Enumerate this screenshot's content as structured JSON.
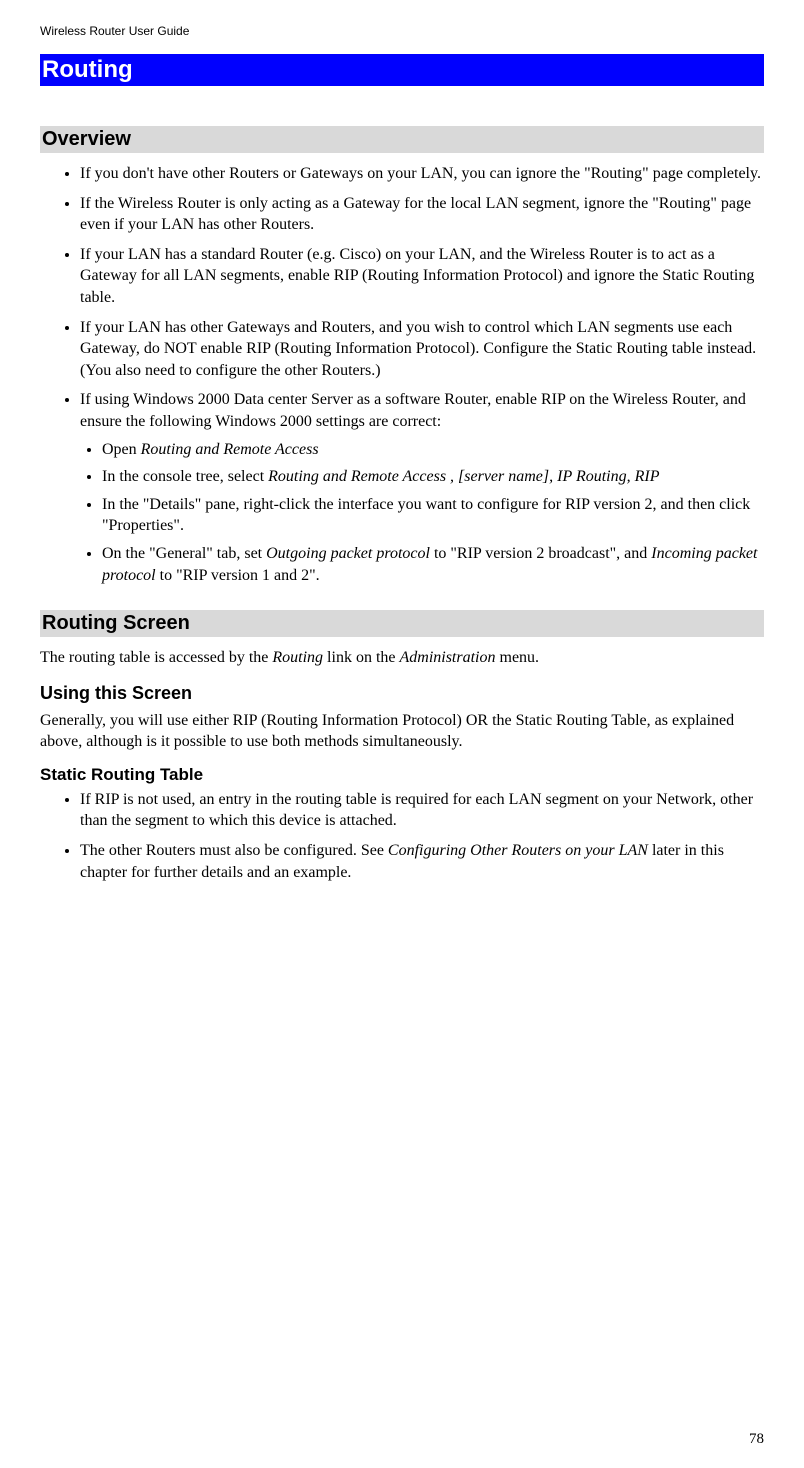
{
  "doc_header": "Wireless Router User Guide",
  "banner": "Routing",
  "overview": {
    "heading": "Overview",
    "items": {
      "b1": "If you don't have other Routers or Gateways on your LAN, you can ignore the \"Routing\" page completely.",
      "b2": "If the Wireless Router is only acting as a Gateway for the local LAN segment, ignore the \"Routing\" page even if your LAN has other Routers.",
      "b3": "If your LAN has a standard Router (e.g. Cisco) on your LAN, and the Wireless Router is to act as a Gateway for all LAN segments, enable RIP (Routing Information Protocol) and ignore the Static Routing table.",
      "b4": "If your LAN has other Gateways and Routers, and you wish to control which LAN segments use each Gateway, do NOT enable RIP (Routing Information Protocol). Configure the Static Routing table instead. (You also need to configure the other Routers.)",
      "b5": "If using Windows 2000 Data center Server as a software Router, enable RIP on the Wireless Router, and ensure the following Windows 2000 settings are correct:",
      "inner": {
        "i1_pre": "Open ",
        "i1_em": "Routing and Remote Access",
        "i2_pre": "In the console tree, select ",
        "i2_em": "Routing and Remote Access , [server name], IP Routing, RIP",
        "i3": "In the \"Details\" pane, right-click the interface you want to configure for RIP version 2, and then click \"Properties\".",
        "i4_pre": "On the \"General\" tab, set ",
        "i4_em1": "Outgoing packet protocol",
        "i4_mid": " to \"RIP version 2 broadcast\", and ",
        "i4_em2": "Incoming packet protocol",
        "i4_post": " to \"RIP version 1 and 2\"."
      }
    }
  },
  "routing_screen": {
    "heading": "Routing Screen",
    "p1_pre": "The routing table is accessed by the ",
    "p1_em1": "Routing",
    "p1_mid": " link on the ",
    "p1_em2": "Administration",
    "p1_post": " menu.",
    "using_heading": "Using this Screen",
    "using_p": "Generally, you will use either RIP (Routing Information Protocol) OR the Static Routing Table, as explained above, although is it possible to use both methods simultaneously.",
    "static_heading": "Static Routing Table",
    "static": {
      "s1": "If RIP is not used, an entry in the routing table is required for each LAN segment on your Network, other than the segment to which this device is attached.",
      "s2_pre": "The other Routers must also be configured. See ",
      "s2_em": "Configuring Other Routers on your LAN",
      "s2_post": " later in this chapter for further details and an example."
    }
  },
  "page_number": "78"
}
